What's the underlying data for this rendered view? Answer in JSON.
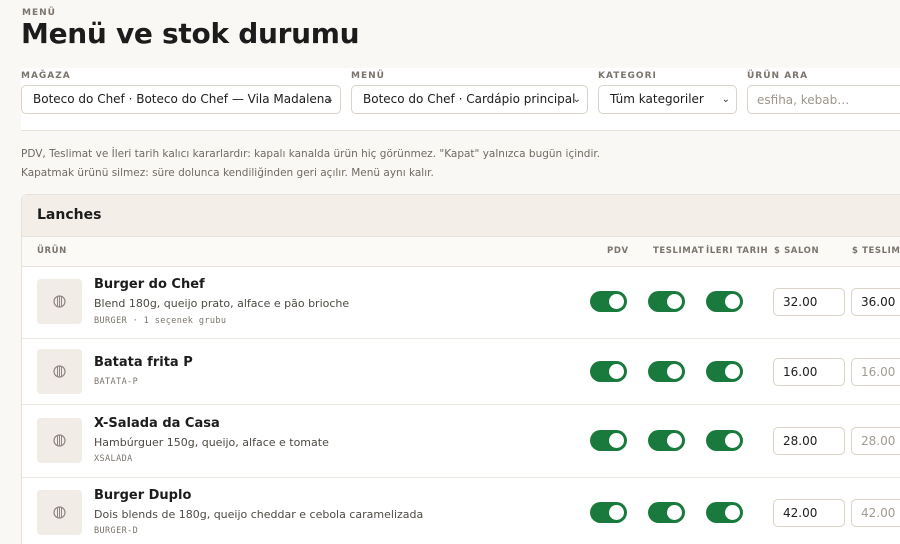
{
  "header": {
    "eyebrow": "MENÜ",
    "title": "Menü ve stok durumu"
  },
  "filters": {
    "store": {
      "label": "MAĞAZA",
      "value": "Boteco do Chef · Boteco do Chef — Vila Madalena"
    },
    "menu": {
      "label": "MENÜ",
      "value": "Boteco do Chef · Cardápio principal"
    },
    "category": {
      "label": "KATEGORI",
      "value": "Tüm kategoriler"
    },
    "search": {
      "label": "ÜRÜN ARA",
      "placeholder": "esfiha, kebab…",
      "value": ""
    }
  },
  "notes": [
    "PDV, Teslimat ve İleri tarih kalıcı kararlardır: kapalı kanalda ürün hiç görünmez. \"Kapat\" yalnızca bugün içindir.",
    "Kapatmak ürünü silmez: süre dolunca kendiliğinden geri açılır. Menü aynı kalır."
  ],
  "section": {
    "title": "Lanches",
    "columns": {
      "product": "ÜRÜN",
      "pdv": "PDV",
      "delivery": "TESLIMAT",
      "future": "İLERI TARIH",
      "salon_price": "$ SALON",
      "delivery_price": "$ TESLIMAT"
    },
    "items": [
      {
        "name": "Burger do Chef",
        "description": "Blend 180g, queijo prato, alface e pão brioche",
        "meta": "BURGER · 1 seçenek grubu",
        "pdv": true,
        "delivery": true,
        "future": true,
        "salon_price": "32.00",
        "delivery_price": "36.00"
      },
      {
        "name": "Batata frita P",
        "description": "",
        "meta": "BATATA-P",
        "pdv": true,
        "delivery": true,
        "future": true,
        "salon_price": "16.00",
        "delivery_price": "16.00"
      },
      {
        "name": "X-Salada da Casa",
        "description": "Hambúrguer 150g, queijo, alface e tomate",
        "meta": "XSALADA",
        "pdv": true,
        "delivery": true,
        "future": true,
        "salon_price": "28.00",
        "delivery_price": "28.00"
      },
      {
        "name": "Burger Duplo",
        "description": "Dois blends de 180g, queijo cheddar e cebola caramelizada",
        "meta": "BURGER-D",
        "pdv": true,
        "delivery": true,
        "future": true,
        "salon_price": "42.00",
        "delivery_price": "42.00"
      }
    ]
  },
  "colors": {
    "toggle_on": "#1a7a3e",
    "background": "#faf8f4",
    "panel_head": "#f3efe8"
  }
}
